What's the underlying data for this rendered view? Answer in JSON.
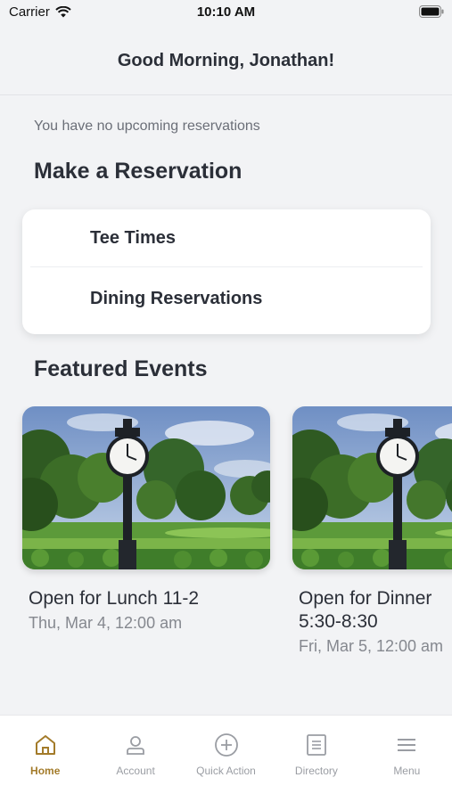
{
  "status_bar": {
    "carrier": "Carrier",
    "time": "10:10 AM",
    "wifi_icon": "wifi-icon",
    "battery_icon": "battery-icon"
  },
  "header": {
    "greeting": "Good Morning, Jonathan!"
  },
  "reservations": {
    "empty_message": "You have no upcoming reservations",
    "section_title": "Make a Reservation",
    "items": [
      {
        "label": "Tee Times"
      },
      {
        "label": "Dining Reservations"
      }
    ]
  },
  "featured": {
    "section_title": "Featured Events",
    "events": [
      {
        "title": "Open for Lunch 11-2",
        "date": "Thu, Mar 4, 12:00 am",
        "image_icon": "clock-tower-photo"
      },
      {
        "title": "Open for Dinner 5:30-8:30",
        "date": "Fri, Mar 5, 12:00 am",
        "image_icon": "clock-tower-photo"
      }
    ]
  },
  "tab_bar": {
    "active_color": "#a37b2a",
    "inactive_color": "#9a9da3",
    "tabs": [
      {
        "label": "Home",
        "icon": "home-icon",
        "active": true
      },
      {
        "label": "Account",
        "icon": "person-icon",
        "active": false
      },
      {
        "label": "Quick Action",
        "icon": "plus-circle-icon",
        "active": false
      },
      {
        "label": "Directory",
        "icon": "list-icon",
        "active": false
      },
      {
        "label": "Menu",
        "icon": "hamburger-icon",
        "active": false
      }
    ]
  }
}
